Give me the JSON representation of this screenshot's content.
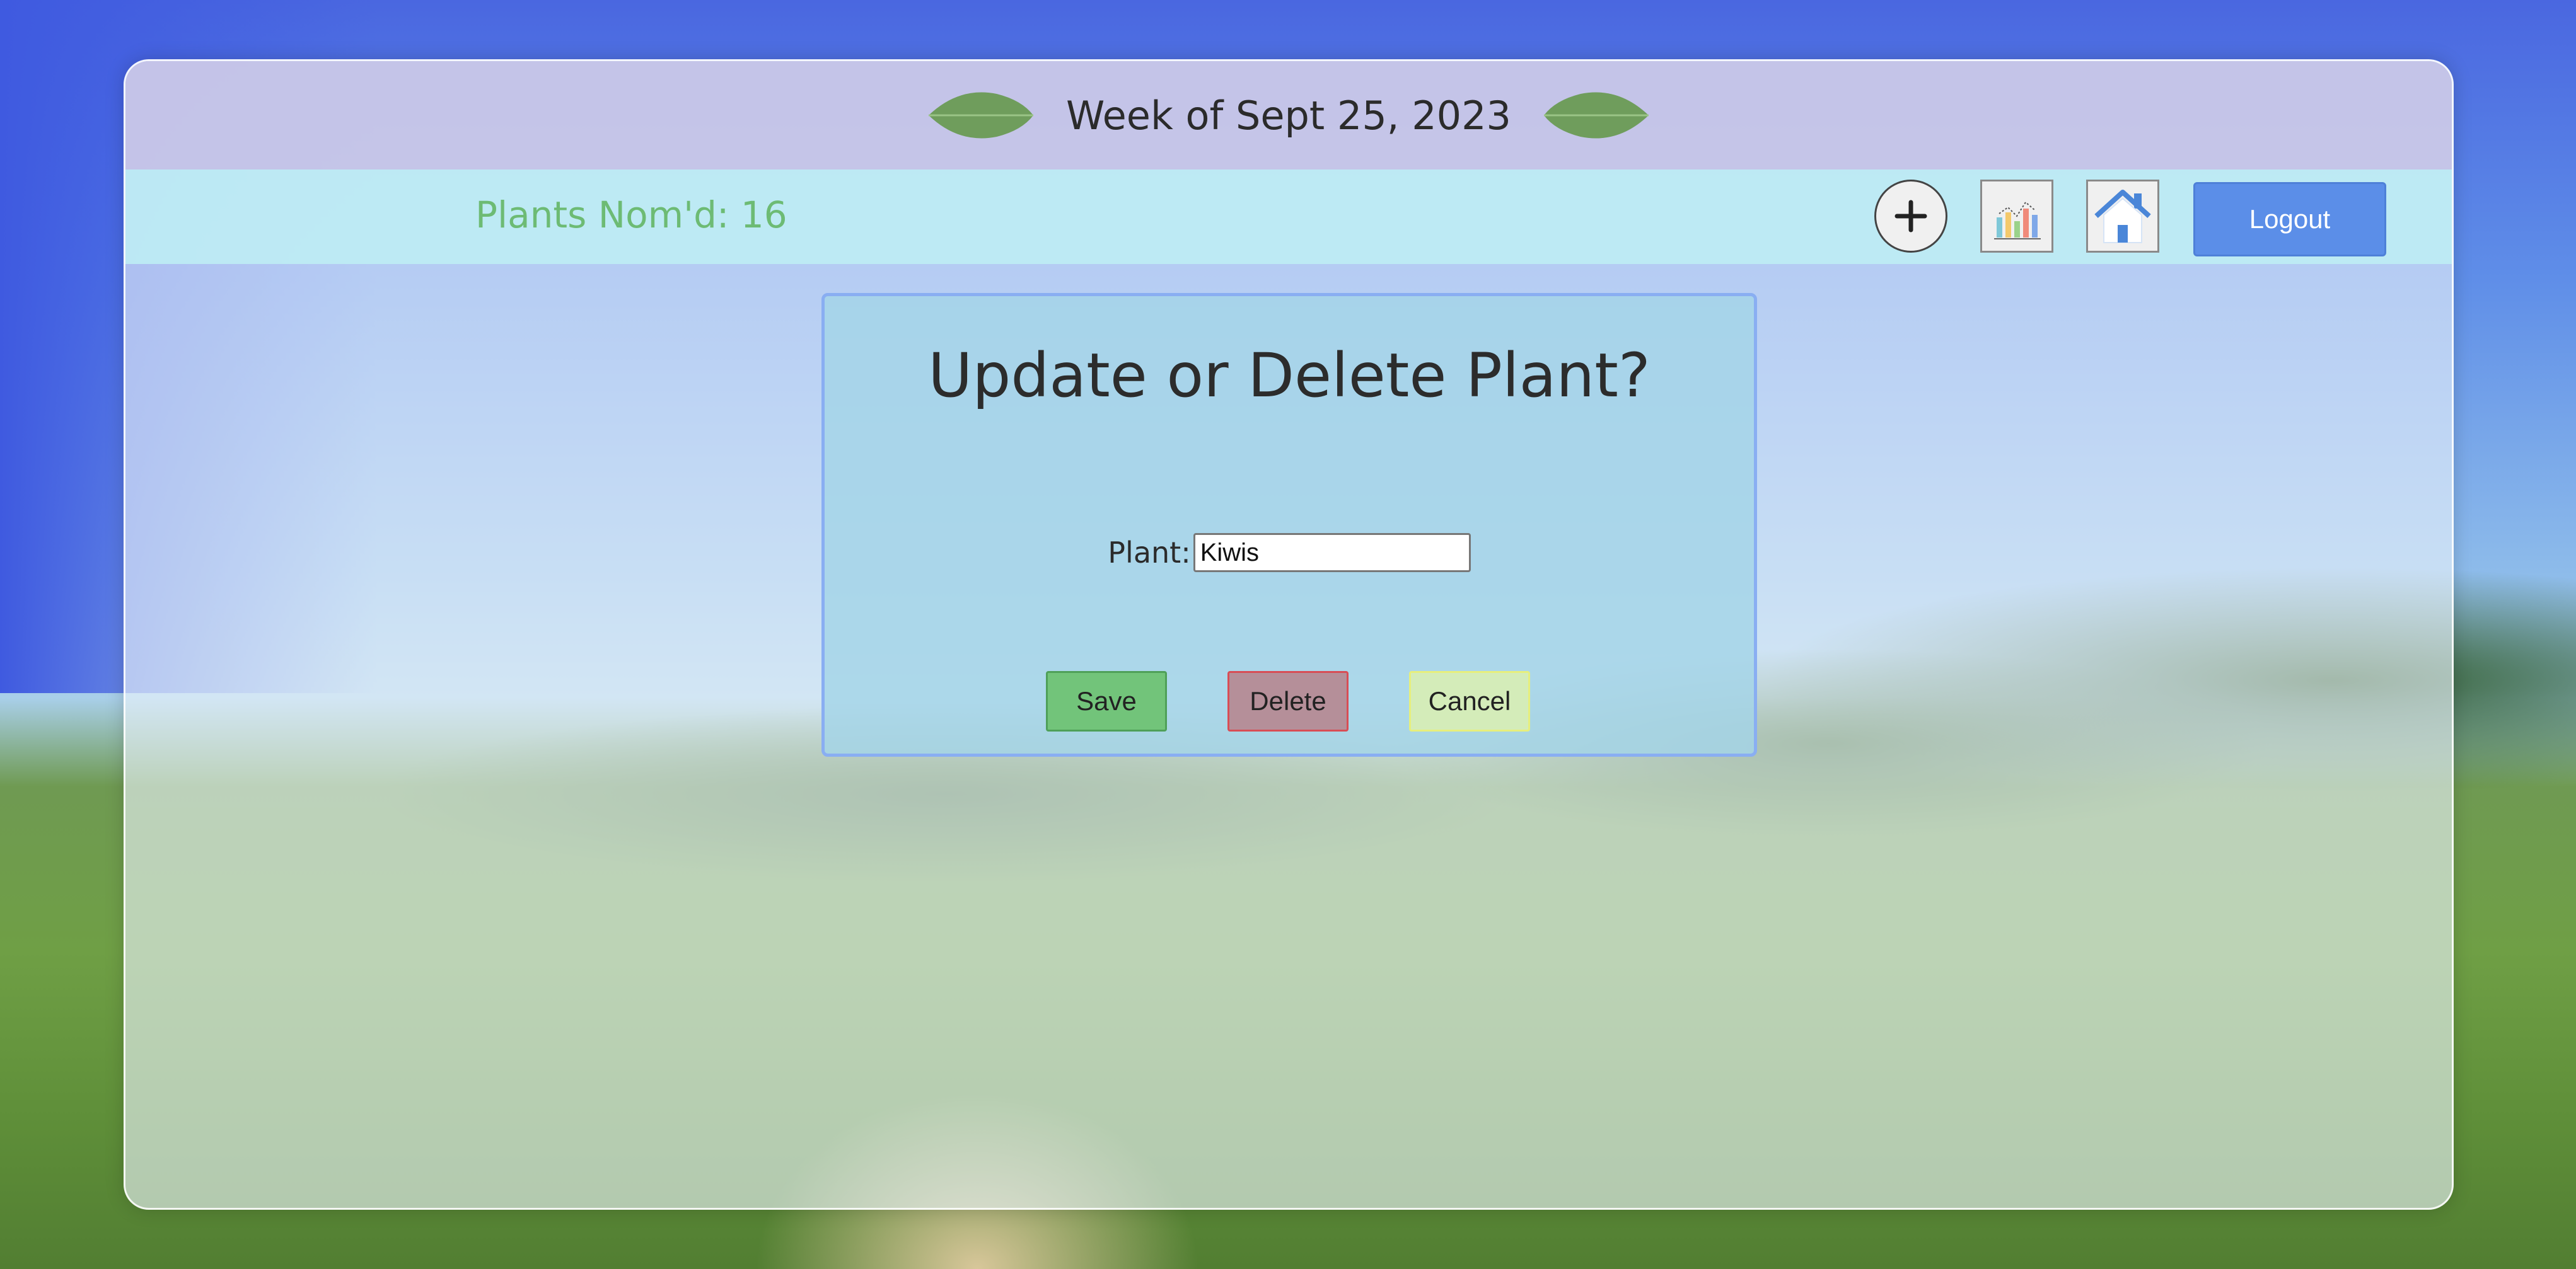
{
  "header": {
    "week_title": "Week of Sept 25, 2023"
  },
  "nav": {
    "count_label": "Plants Nom'd: 16",
    "add_icon": "plus-icon",
    "chart_icon": "bar-chart-icon",
    "home_icon": "home-icon",
    "logout_label": "Logout"
  },
  "dialog": {
    "title": "Update or Delete Plant?",
    "field_label": "Plant:",
    "field_value": "Kiwis",
    "save_label": "Save",
    "delete_label": "Delete",
    "cancel_label": "Cancel"
  },
  "colors": {
    "accent": "#5b8ee8",
    "count_text": "#6dbb74",
    "save": "#72c47a",
    "delete": "#b58f99",
    "cancel": "#d4ecb9"
  }
}
